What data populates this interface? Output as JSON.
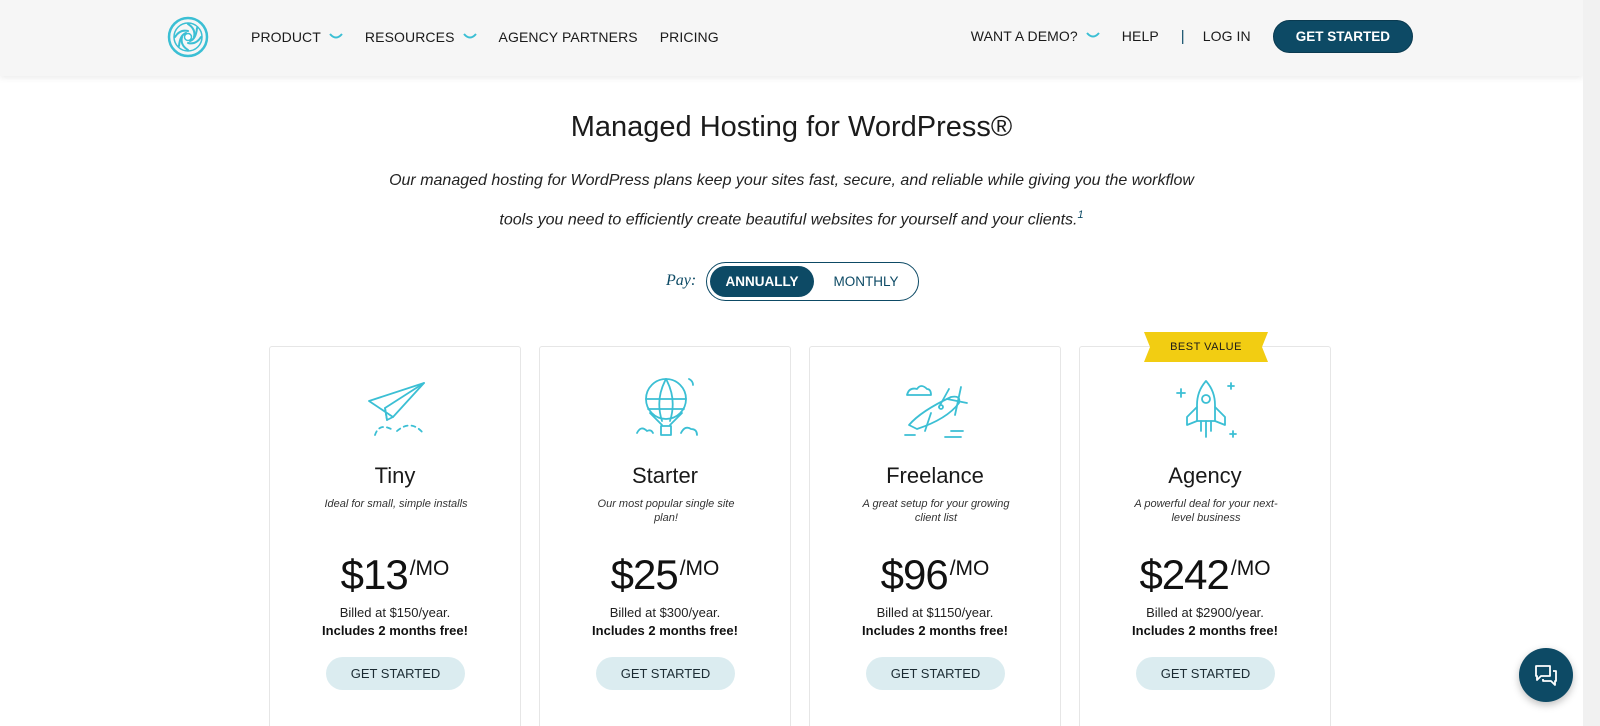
{
  "header": {
    "nav": [
      {
        "label": "PRODUCT"
      },
      {
        "label": "RESOURCES"
      },
      {
        "label": "AGENCY PARTNERS"
      },
      {
        "label": "PRICING"
      }
    ],
    "demo_label": "WANT A DEMO?",
    "help_label": "HELP",
    "separator": "|",
    "login_label": "LOG IN",
    "cta_label": "GET STARTED"
  },
  "hero": {
    "title": "Managed Hosting for WordPress®",
    "subtitle": "Our managed hosting for WordPress plans keep your sites fast, secure, and reliable while giving you the workflow tools you need to efficiently create beautiful websites for yourself and your clients.",
    "footnote": "1"
  },
  "billing": {
    "pay_label": "Pay:",
    "annually": "ANNUALLY",
    "monthly": "MONTHLY",
    "selected": "ANNUALLY"
  },
  "plans": [
    {
      "name": "Tiny",
      "desc": "Ideal for small, simple installs",
      "price": "$13",
      "unit": "/MO",
      "billed": "Billed at $150/year.",
      "free": "Includes 2 months free!",
      "cta": "GET STARTED",
      "icon": "paper-plane-icon"
    },
    {
      "name": "Starter",
      "desc": "Our most popular single site plan!",
      "price": "$25",
      "unit": "/MO",
      "billed": "Billed at $300/year.",
      "free": "Includes 2 months free!",
      "cta": "GET STARTED",
      "icon": "hot-air-balloon-icon"
    },
    {
      "name": "Freelance",
      "desc": "A great setup for your growing client list",
      "price": "$96",
      "unit": "/MO",
      "billed": "Billed at $1150/year.",
      "free": "Includes 2 months free!",
      "cta": "GET STARTED",
      "icon": "propeller-plane-icon"
    },
    {
      "name": "Agency",
      "desc": "A powerful deal for your next-level business",
      "price": "$242",
      "unit": "/MO",
      "billed": "Billed at $2900/year.",
      "free": "Includes 2 months free!",
      "cta": "GET STARTED",
      "icon": "rocket-icon"
    }
  ],
  "badge": "BEST VALUE",
  "colors": {
    "brand": "#0d4a65",
    "accent": "#3bbfd4",
    "badge": "#f2cd12",
    "button_light": "#dbecf0"
  }
}
